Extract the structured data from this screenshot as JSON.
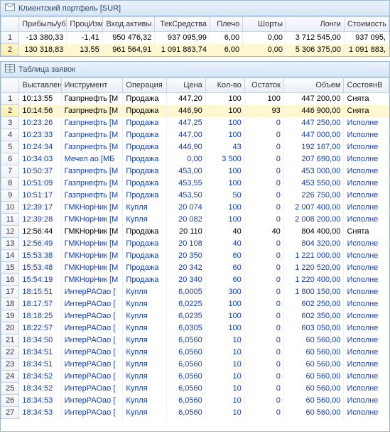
{
  "portfolio": {
    "title": "Клиентский портфель [SUR]",
    "headers": [
      "",
      "Прибыль/убПроцИзм",
      "Вход.активы",
      "ТекСредства",
      "Плечо",
      "Шорты",
      "Лонги",
      "Стоимость"
    ],
    "h": {
      "c0": "",
      "c1": "Прибыль/уб",
      "c2": "ПроцИзм",
      "c3": "Вход.активы",
      "c4": "ТекСредства",
      "c5": "Плечо",
      "c6": "Шорты",
      "c7": "Лонги",
      "c8": "Стоимость"
    },
    "rows": [
      {
        "n": "1",
        "pl": "-13 380,33",
        "pct": "-1,41",
        "inp": "950 476,32",
        "cur": "937 095,99",
        "lev": "6,00",
        "sh": "0,00",
        "lg": "3 712 545,00",
        "cost": "937 095,"
      },
      {
        "n": "2",
        "pl": "130 318,83",
        "pct": "13,55",
        "inp": "961 564,91",
        "cur": "1 091 883,74",
        "lev": "6,00",
        "sh": "0,00",
        "lg": "5 306 375,00",
        "cost": "1 091 883,"
      }
    ]
  },
  "orders": {
    "title": "Таблица заявок",
    "h": {
      "c0": "",
      "c1": "Выставлен",
      "c2": "Инструмент",
      "c3": "Операция",
      "c4": "Цена",
      "c5": "Кол-во",
      "c6": "Остаток",
      "c7": "Объем",
      "c8": "СостоянВ"
    },
    "rows": [
      {
        "n": "1",
        "t": "10:13:55",
        "ins": "Газпрнефть [М",
        "op": "Продажа",
        "price": "447,20",
        "qty": "100",
        "rem": "100",
        "vol": "447 200,00",
        "st": "Снята",
        "cls": ""
      },
      {
        "n": "2",
        "t": "10:14:56",
        "ins": "Газпрнефть [М",
        "op": "Продажа",
        "price": "446,90",
        "qty": "100",
        "rem": "93",
        "vol": "446 900,00",
        "st": "Снята",
        "cls": "selected"
      },
      {
        "n": "3",
        "t": "10:23:26",
        "ins": "Газпрнефть [М",
        "op": "Продажа",
        "price": "447,25",
        "qty": "100",
        "rem": "0",
        "vol": "447 250,00",
        "st": "Исполне",
        "cls": "blue"
      },
      {
        "n": "4",
        "t": "10:23:33",
        "ins": "Газпрнефть [М",
        "op": "Продажа",
        "price": "447,00",
        "qty": "100",
        "rem": "0",
        "vol": "447 000,00",
        "st": "Исполне",
        "cls": "blue"
      },
      {
        "n": "5",
        "t": "10:24:34",
        "ins": "Газпрнефть [М",
        "op": "Продажа",
        "price": "446,90",
        "qty": "43",
        "rem": "0",
        "vol": "192 167,00",
        "st": "Исполне",
        "cls": "blue"
      },
      {
        "n": "6",
        "t": "10:34:03",
        "ins": "Мечел ао [МБ",
        "op": "Продажа",
        "price": "0,00",
        "qty": "3 500",
        "rem": "0",
        "vol": "207 690,00",
        "st": "Исполне",
        "cls": "blue"
      },
      {
        "n": "7",
        "t": "10:50:37",
        "ins": "Газпрнефть [М",
        "op": "Продажа",
        "price": "453,00",
        "qty": "100",
        "rem": "0",
        "vol": "453 000,00",
        "st": "Исполне",
        "cls": "blue"
      },
      {
        "n": "8",
        "t": "10:51:09",
        "ins": "Газпрнефть [М",
        "op": "Продажа",
        "price": "453,55",
        "qty": "100",
        "rem": "0",
        "vol": "453 550,00",
        "st": "Исполне",
        "cls": "blue"
      },
      {
        "n": "9",
        "t": "10:51:17",
        "ins": "Газпрнефть [М",
        "op": "Продажа",
        "price": "453,50",
        "qty": "50",
        "rem": "0",
        "vol": "226 750,00",
        "st": "Исполне",
        "cls": "blue"
      },
      {
        "n": "10",
        "t": "12:39:17",
        "ins": "ГМКНорНик [М",
        "op": "Купля",
        "price": "20 074",
        "qty": "100",
        "rem": "0",
        "vol": "2 007 400,00",
        "st": "Исполне",
        "cls": "blue"
      },
      {
        "n": "11",
        "t": "12:39:28",
        "ins": "ГМКНорНик [М",
        "op": "Купля",
        "price": "20 082",
        "qty": "100",
        "rem": "0",
        "vol": "2 008 200,00",
        "st": "Исполне",
        "cls": "blue"
      },
      {
        "n": "12",
        "t": "12:56:44",
        "ins": "ГМКНорНик [М",
        "op": "Продажа",
        "price": "20 110",
        "qty": "40",
        "rem": "40",
        "vol": "804 400,00",
        "st": "Снята",
        "cls": ""
      },
      {
        "n": "13",
        "t": "12:56:49",
        "ins": "ГМКНорНик [М",
        "op": "Продажа",
        "price": "20 108",
        "qty": "40",
        "rem": "0",
        "vol": "804 320,00",
        "st": "Исполне",
        "cls": "blue"
      },
      {
        "n": "14",
        "t": "15:53:38",
        "ins": "ГМКНорНик [М",
        "op": "Продажа",
        "price": "20 350",
        "qty": "60",
        "rem": "0",
        "vol": "1 221 000,00",
        "st": "Исполне",
        "cls": "blue"
      },
      {
        "n": "15",
        "t": "15:53:48",
        "ins": "ГМКНорНик [М",
        "op": "Продажа",
        "price": "20 342",
        "qty": "60",
        "rem": "0",
        "vol": "1 220 520,00",
        "st": "Исполне",
        "cls": "blue"
      },
      {
        "n": "16",
        "t": "15:54:19",
        "ins": "ГМКНорНик [М",
        "op": "Продажа",
        "price": "20 340",
        "qty": "60",
        "rem": "0",
        "vol": "1 220 400,00",
        "st": "Исполне",
        "cls": "blue"
      },
      {
        "n": "17",
        "t": "18:15:51",
        "ins": "ИнтерРАОао [",
        "op": "Купля",
        "price": "6,0005",
        "qty": "300",
        "rem": "0",
        "vol": "1 800 150,00",
        "st": "Исполне",
        "cls": "blue"
      },
      {
        "n": "18",
        "t": "18:17:57",
        "ins": "ИнтерРАОао [",
        "op": "Купля",
        "price": "6,0225",
        "qty": "100",
        "rem": "0",
        "vol": "602 250,00",
        "st": "Исполне",
        "cls": "blue"
      },
      {
        "n": "19",
        "t": "18:18:25",
        "ins": "ИнтерРАОао [",
        "op": "Купля",
        "price": "6,0235",
        "qty": "100",
        "rem": "0",
        "vol": "602 350,00",
        "st": "Исполне",
        "cls": "blue"
      },
      {
        "n": "20",
        "t": "18:22:57",
        "ins": "ИнтерРАОао [",
        "op": "Купля",
        "price": "6,0305",
        "qty": "100",
        "rem": "0",
        "vol": "603 050,00",
        "st": "Исполне",
        "cls": "blue"
      },
      {
        "n": "21",
        "t": "18:34:50",
        "ins": "ИнтерРАОао [",
        "op": "Купля",
        "price": "6,0560",
        "qty": "10",
        "rem": "0",
        "vol": "60 560,00",
        "st": "Исполне",
        "cls": "blue"
      },
      {
        "n": "22",
        "t": "18:34:51",
        "ins": "ИнтерРАОао [",
        "op": "Купля",
        "price": "6,0560",
        "qty": "10",
        "rem": "0",
        "vol": "60 560,00",
        "st": "Исполне",
        "cls": "blue"
      },
      {
        "n": "23",
        "t": "18:34:51",
        "ins": "ИнтерРАОао [",
        "op": "Купля",
        "price": "6,0560",
        "qty": "10",
        "rem": "0",
        "vol": "60 560,00",
        "st": "Исполне",
        "cls": "blue"
      },
      {
        "n": "24",
        "t": "18:34:52",
        "ins": "ИнтерРАОао [",
        "op": "Купля",
        "price": "6,0560",
        "qty": "10",
        "rem": "0",
        "vol": "60 560,00",
        "st": "Исполне",
        "cls": "blue"
      },
      {
        "n": "25",
        "t": "18:34:52",
        "ins": "ИнтерРАОао [",
        "op": "Купля",
        "price": "6,0560",
        "qty": "10",
        "rem": "0",
        "vol": "60 560,00",
        "st": "Исполне",
        "cls": "blue"
      },
      {
        "n": "26",
        "t": "18:34:53",
        "ins": "ИнтерРАОао [",
        "op": "Купля",
        "price": "6,0560",
        "qty": "10",
        "rem": "0",
        "vol": "60 560,00",
        "st": "Исполне",
        "cls": "blue"
      },
      {
        "n": "27",
        "t": "18:34:53",
        "ins": "ИнтерРАОао [",
        "op": "Купля",
        "price": "6,0560",
        "qty": "10",
        "rem": "0",
        "vol": "60 560,00",
        "st": "Исполне",
        "cls": "blue"
      }
    ]
  }
}
